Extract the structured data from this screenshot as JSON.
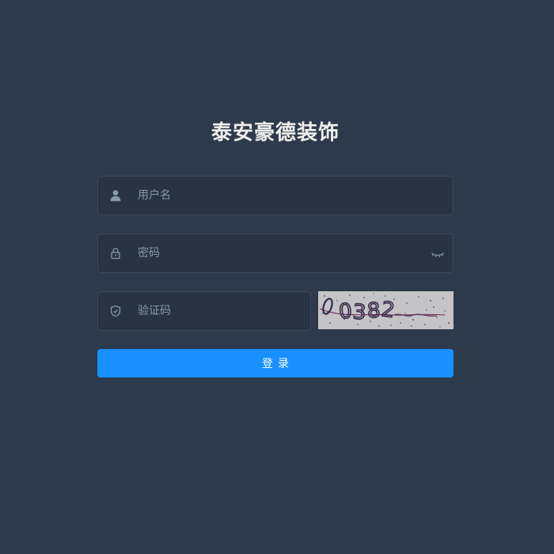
{
  "login": {
    "title": "泰安豪德装饰",
    "username": {
      "icon": "user-icon",
      "placeholder": "用户名",
      "value": ""
    },
    "password": {
      "icon": "lock-icon",
      "placeholder": "密码",
      "value": "",
      "toggle_icon": "eye-closed-icon"
    },
    "captcha": {
      "icon": "shield-icon",
      "placeholder": "验证码",
      "value": "",
      "image_text": "0382"
    },
    "submit_label": "登录"
  },
  "colors": {
    "background": "#2d3a4b",
    "title": "#eeeeee",
    "icon": "#889aa4",
    "button": "#1890ff"
  }
}
